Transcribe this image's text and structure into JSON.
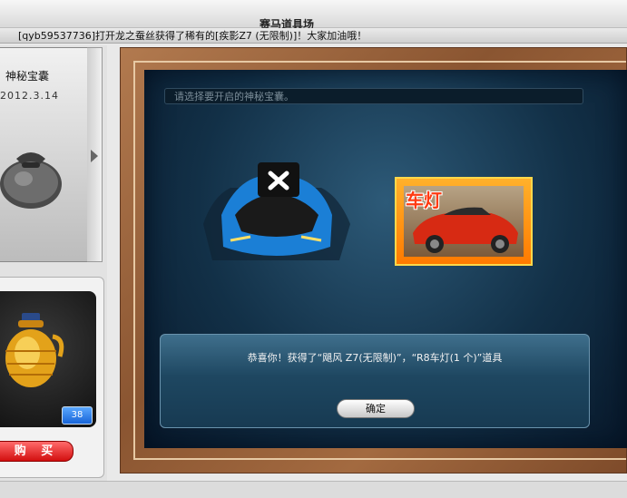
{
  "window": {
    "title": "赛马道具场"
  },
  "marquee": {
    "text": "[qyb59537736]打开龙之蚕丝获得了稀有的[疾影Z7 (无限制)]！大家加油哦！"
  },
  "left": {
    "item1": {
      "name": "神秘宝囊",
      "date": "2012.3.14",
      "image_icon": "bag-icon"
    },
    "item2": {
      "image_icon": "jar-icon",
      "count": "38",
      "buy_label": "购 买"
    }
  },
  "scene": {
    "search_placeholder": "请选择要开启的神秘宝囊。",
    "car1_icon": "blue-sports-car-icon",
    "car2_label": "车灯",
    "dialog": {
      "message": "恭喜你！获得了“飓风 Z7(无限制)”，“R8车灯(1 个)”道具",
      "ok_label": "确定"
    }
  },
  "colors": {
    "accent_blue": "#1764d8",
    "buy_red": "#d30f0f",
    "frame_wood": "#8a5531",
    "scene_bg": "#123047"
  }
}
